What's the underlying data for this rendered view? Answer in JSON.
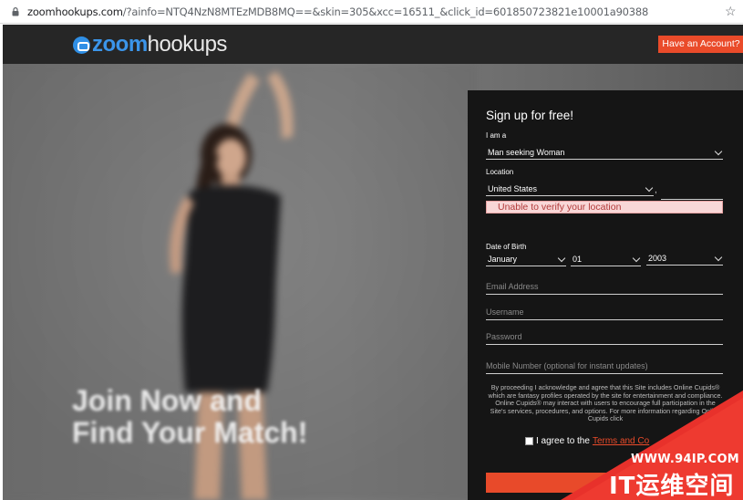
{
  "browser": {
    "url_host": "zoomhookups.com",
    "url_rest": "/?ainfo=NTQ4NzN8MTEzMDB8MQ==&skin=305&xcc=16511_&click_id=601850723821e10001a90388",
    "lock_icon": "lock-icon",
    "star_icon": "star-icon"
  },
  "header": {
    "logo_zoom": "zoom",
    "logo_hookups": "hookups",
    "account_button": "Have an Account?"
  },
  "hero": {
    "line1": "Join Now and",
    "line2": "Find Your Match!"
  },
  "signup": {
    "title": "Sign up for free!",
    "iam_label": "I am a",
    "iam_value": "Man seeking Woman",
    "location_label": "Location",
    "location_value": "United States",
    "comma": ",",
    "location_error": "Unable to verify your location",
    "dob_label": "Date of Birth",
    "dob_month": "January",
    "dob_day": "01",
    "dob_year": "2003",
    "email_placeholder": "Email Address",
    "username_placeholder": "Username",
    "password_placeholder": "Password",
    "mobile_placeholder": "Mobile Number (optional for instant updates)",
    "legal_text": "By proceeding I acknowledge and agree that this Site includes Online Cupids® which are fantasy profiles operated by the site for entertainment and compliance. Online Cupids® may interact with users to encourage full participation in the Site's services, procedures, and options. For more information regarding Online Cupids click",
    "agree_text": "I agree to the",
    "terms_link": "Terms and Co"
  },
  "watermark": {
    "site": "WWW.94IP.COM",
    "name": "IT运维空间"
  },
  "colors": {
    "accent": "#ea4b2a",
    "logo_blue": "#3b95ea",
    "panel_bg": "#151515",
    "header_bg": "#262626",
    "error_bg": "#f8d7d7"
  }
}
